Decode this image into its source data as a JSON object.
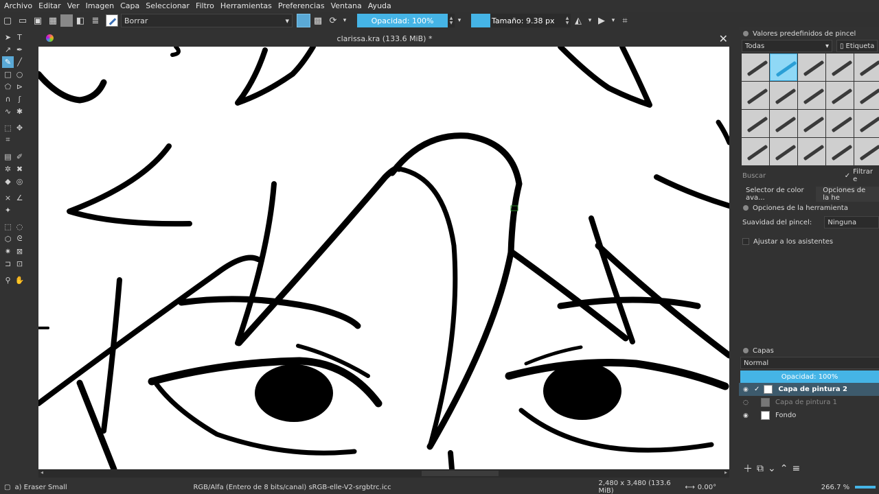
{
  "menu": [
    "Archivo",
    "Editar",
    "Ver",
    "Imagen",
    "Capa",
    "Seleccionar",
    "Filtro",
    "Herramientas",
    "Preferencias",
    "Ventana",
    "Ayuda"
  ],
  "toolbar": {
    "preset_name": "Borrar",
    "opacity_label": "Opacidad: 100%",
    "size_label": "Tamaño: 9.38 px"
  },
  "document": {
    "title": "clarissa.kra (133.6 MiB) *"
  },
  "brush_presets": {
    "title": "Valores predefinidos de pincel",
    "filter_value": "Todas",
    "tag_label": "Etiqueta",
    "search_placeholder": "Buscar",
    "filter_checkbox_label": "Filtrar e"
  },
  "tool_options": {
    "tab_color": "Selector de color ava...",
    "tab_options": "Opciones de la he",
    "title": "Opciones de la herramienta",
    "smoothing_label": "Suavidad del pincel:",
    "smoothing_value": "Ninguna",
    "assistants_label": "Ajustar a los asistentes"
  },
  "layers": {
    "title": "Capas",
    "blend_mode": "Normal",
    "opacity_label": "Opacidad:  100%",
    "items": [
      {
        "name": "Capa de pintura 2"
      },
      {
        "name": "Capa de pintura 1"
      },
      {
        "name": "Fondo"
      }
    ]
  },
  "status": {
    "tool_preset": "a) Eraser Small",
    "color_space": "RGB/Alfa (Entero de 8 bits/canal)  sRGB-elle-V2-srgbtrc.icc",
    "image_size": "2,480 x 3,480 (133.6 MiB)",
    "rotation": "0.00°",
    "zoom": "266.7 %"
  },
  "colors": {
    "accent": "#45b4e6",
    "panel": "#323232",
    "canvas": "#ffffff"
  }
}
